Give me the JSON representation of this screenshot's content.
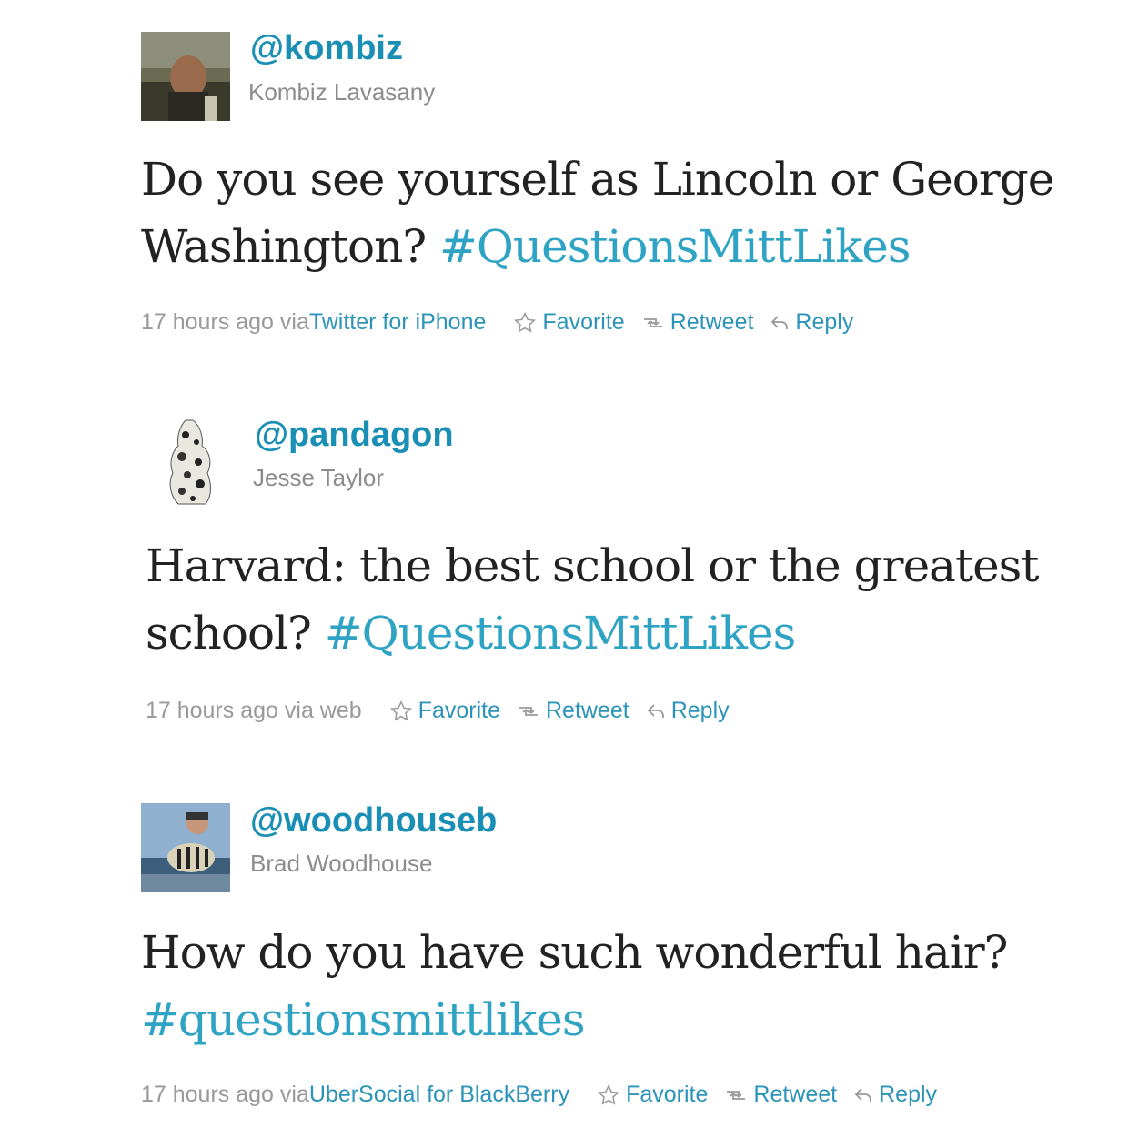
{
  "tweets": [
    {
      "handle": "@kombiz",
      "name": "Kombiz Lavasany",
      "text_line1": "Do you see yourself as Lincoln or George",
      "text_line2": "Washington? ",
      "hashtag": "#QuestionsMittLikes",
      "time": "17 hours ago via ",
      "via": "Twitter for iPhone",
      "favorite": "Favorite",
      "retweet": "Retweet",
      "reply": "Reply"
    },
    {
      "handle": "@pandagon",
      "name": "Jesse Taylor",
      "text_line1": "Harvard: the best school or the greatest",
      "text_line2": "school? ",
      "hashtag": "#QuestionsMittLikes",
      "time": "17 hours ago via web",
      "via": "",
      "favorite": "Favorite",
      "retweet": "Retweet",
      "reply": "Reply"
    },
    {
      "handle": "@woodhouseb",
      "name": "Brad Woodhouse",
      "text_line1": "How do you have such wonderful hair?",
      "text_line2": "",
      "hashtag": "#questionsmittlikes",
      "time": "17 hours ago via ",
      "via": "UberSocial for BlackBerry",
      "favorite": "Favorite",
      "retweet": "Retweet",
      "reply": "Reply"
    }
  ],
  "colors": {
    "handle": "#1a8fb5",
    "hashtag": "#2ea3c4",
    "link": "#2b94b8",
    "meta": "#999999",
    "text": "#222222"
  }
}
